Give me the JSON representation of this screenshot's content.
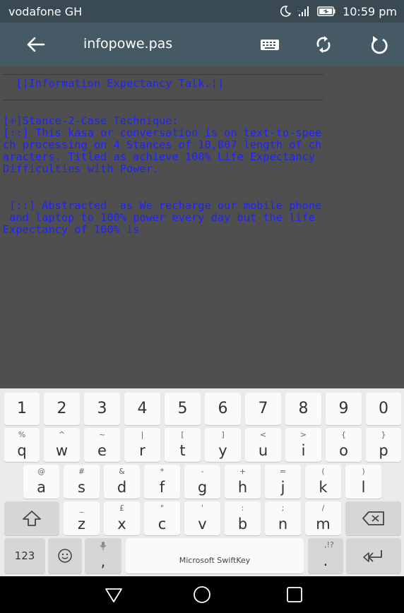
{
  "status": {
    "carrier": "vodafone GH",
    "time": "10:59 pm"
  },
  "appbar": {
    "title": "infopowe.pas"
  },
  "editor": {
    "lines": [
      "  [¦Information Expectancy Talk.¦]",
      "[÷]Stance-2-Case Technique:",
      "[::] This kasa or conversation is on text-to-spee",
      "ch processing on 4 Stances of 10,807 length of ch",
      "aracters. Titled as achieve 100% Life Expectancy",
      "Difficulties with Power.",
      " [::] Abstracted  as We recharge our mobile phone",
      " and laptop to 100% power every day but the life",
      "Expectancy of 100% is"
    ]
  },
  "keyboard": {
    "numbers": [
      "1",
      "2",
      "3",
      "4",
      "5",
      "6",
      "7",
      "8",
      "9",
      "0"
    ],
    "row1": [
      {
        "main": "q",
        "sub": "%"
      },
      {
        "main": "w",
        "sub": "^"
      },
      {
        "main": "e",
        "sub": "~"
      },
      {
        "main": "r",
        "sub": "|"
      },
      {
        "main": "t",
        "sub": "["
      },
      {
        "main": "y",
        "sub": "]"
      },
      {
        "main": "u",
        "sub": "<"
      },
      {
        "main": "i",
        "sub": ">"
      },
      {
        "main": "o",
        "sub": "{"
      },
      {
        "main": "p",
        "sub": "}"
      }
    ],
    "row2": [
      {
        "main": "a",
        "sub": "@"
      },
      {
        "main": "s",
        "sub": "#"
      },
      {
        "main": "d",
        "sub": "&"
      },
      {
        "main": "f",
        "sub": "*"
      },
      {
        "main": "g",
        "sub": "-"
      },
      {
        "main": "h",
        "sub": "+"
      },
      {
        "main": "j",
        "sub": "="
      },
      {
        "main": "k",
        "sub": "("
      },
      {
        "main": "l",
        "sub": ")"
      }
    ],
    "row3": [
      {
        "main": "z",
        "sub": "_"
      },
      {
        "main": "x",
        "sub": "£"
      },
      {
        "main": "c",
        "sub": "\""
      },
      {
        "main": "v",
        "sub": "'"
      },
      {
        "main": "b",
        "sub": ":"
      },
      {
        "main": "n",
        "sub": ";"
      },
      {
        "main": "m",
        "sub": "/"
      }
    ],
    "num_toggle": "123",
    "comma": ",",
    "space_label": "Microsoft SwiftKey",
    "period": ".",
    "period_sub": ",!?"
  },
  "colors": {
    "editor_text": "#1e22ff",
    "appbar": "#455a64",
    "editor_bg": "#4f4f4f"
  }
}
